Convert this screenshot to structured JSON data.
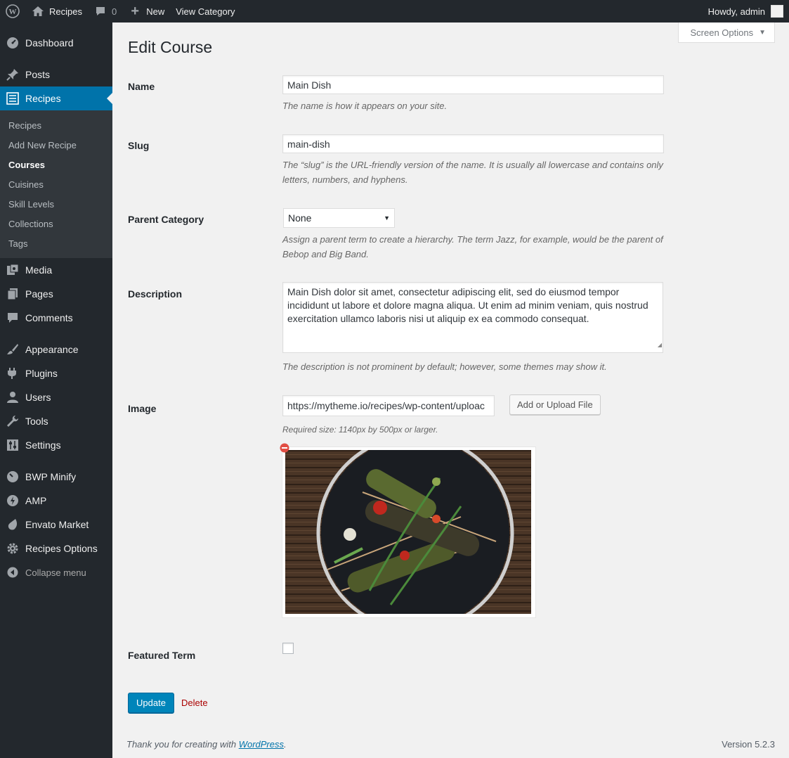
{
  "adminbar": {
    "site_name": "Recipes",
    "comments_count": "0",
    "new_label": "New",
    "view_label": "View Category",
    "howdy": "Howdy, admin"
  },
  "sidebar": {
    "dashboard": "Dashboard",
    "posts": "Posts",
    "recipes": "Recipes",
    "submenu": [
      "Recipes",
      "Add New Recipe",
      "Courses",
      "Cuisines",
      "Skill Levels",
      "Collections",
      "Tags"
    ],
    "media": "Media",
    "pages": "Pages",
    "comments": "Comments",
    "appearance": "Appearance",
    "plugins": "Plugins",
    "users": "Users",
    "tools": "Tools",
    "settings": "Settings",
    "bwp": "BWP Minify",
    "amp": "AMP",
    "envato": "Envato Market",
    "recipes_options": "Recipes Options",
    "collapse": "Collapse menu"
  },
  "screen_options": "Screen Options",
  "page_title": "Edit Course",
  "form": {
    "name_label": "Name",
    "name_value": "Main Dish",
    "name_desc": "The name is how it appears on your site.",
    "slug_label": "Slug",
    "slug_value": "main-dish",
    "slug_desc": "The “slug” is the URL-friendly version of the name. It is usually all lowercase and contains only letters, numbers, and hyphens.",
    "parent_label": "Parent Category",
    "parent_value": "None",
    "parent_desc": "Assign a parent term to create a hierarchy. The term Jazz, for example, would be the parent of Bebop and Big Band.",
    "description_label": "Description",
    "description_value": "Main Dish dolor sit amet, consectetur adipiscing elit, sed do eiusmod tempor incididunt ut labore et dolore magna aliqua. Ut enim ad minim veniam, quis nostrud exercitation ullamco laboris nisi ut aliquip ex ea commodo consequat.",
    "description_desc": "The description is not prominent by default; however, some themes may show it.",
    "image_label": "Image",
    "image_value": "https://mytheme.io/recipes/wp-content/uploac",
    "upload_button": "Add or Upload File",
    "image_desc": "Required size: 1140px by 500px or larger.",
    "featured_label": "Featured Term",
    "update_button": "Update",
    "delete_link": "Delete"
  },
  "footer": {
    "thanks_prefix": "Thank you for creating with ",
    "thanks_link": "WordPress",
    "thanks_suffix": ".",
    "version": "Version 5.2.3"
  },
  "colors": {
    "accent": "#0073aa",
    "sidebar_bg": "#23282d",
    "primary_button": "#0085ba",
    "delete": "#aa0000"
  }
}
